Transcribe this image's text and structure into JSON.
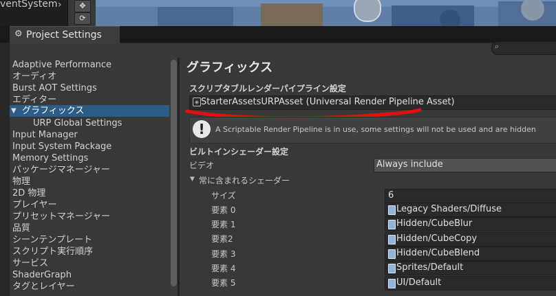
{
  "background": {
    "hierarchy_label": "ventSystem",
    "hierarchy_arrow": "›"
  },
  "window": {
    "tab_title": "Project Settings",
    "tab_icon": "gear-icon",
    "search_icon": "search-icon"
  },
  "sidebar": {
    "items": [
      {
        "label": "Adaptive Performance"
      },
      {
        "label": "オーディオ"
      },
      {
        "label": "Burst AOT Settings"
      },
      {
        "label": "エディター"
      },
      {
        "label": "グラフィックス",
        "selected": true
      },
      {
        "label": "URP Global Settings"
      },
      {
        "label": "Input Manager"
      },
      {
        "label": "Input System Package"
      },
      {
        "label": "Memory Settings"
      },
      {
        "label": "パッケージマネージャー"
      },
      {
        "label": "物理"
      },
      {
        "label": "2D 物理"
      },
      {
        "label": "プレイヤー"
      },
      {
        "label": "プリセットマネージャー"
      },
      {
        "label": "品質"
      },
      {
        "label": "シーンテンプレート"
      },
      {
        "label": "スクリプト実行順序"
      },
      {
        "label": "サービス"
      },
      {
        "label": "ShaderGraph"
      },
      {
        "label": "タグとレイヤー"
      }
    ],
    "expand_arrow": "▼"
  },
  "main": {
    "title": "グラフィックス",
    "srp_label": "スクリプタブルレンダーパイプライン設定",
    "srp_asset": "StarterAssetsURPAsset (Universal Render Pipeline Asset)",
    "help_text": "A Scriptable Render Pipeline is in use, some settings will not be used and are hidden",
    "warn_glyph": "!",
    "builtin_label": "ビルトインシェーダー設定",
    "video_label": "ビデオ",
    "video_value": "Always include",
    "shaders_label": "常に含まれるシェーダー",
    "shaders_arrow": "▼",
    "size_label": "サイズ",
    "size_value": "6",
    "elements": [
      {
        "label": "要素 0",
        "value": "Legacy Shaders/Diffuse"
      },
      {
        "label": "要素 1",
        "value": "Hidden/CubeBlur"
      },
      {
        "label": "要素2",
        "value": "Hidden/CubeCopy"
      },
      {
        "label": "要素 3",
        "value": "Hidden/CubeBlend"
      },
      {
        "label": "要素 4",
        "value": "Sprites/Default"
      },
      {
        "label": "要素 5",
        "value": "UI/Default"
      }
    ]
  },
  "colors": {
    "selection": "#2c5d87",
    "annotation_red": "#e01010"
  }
}
